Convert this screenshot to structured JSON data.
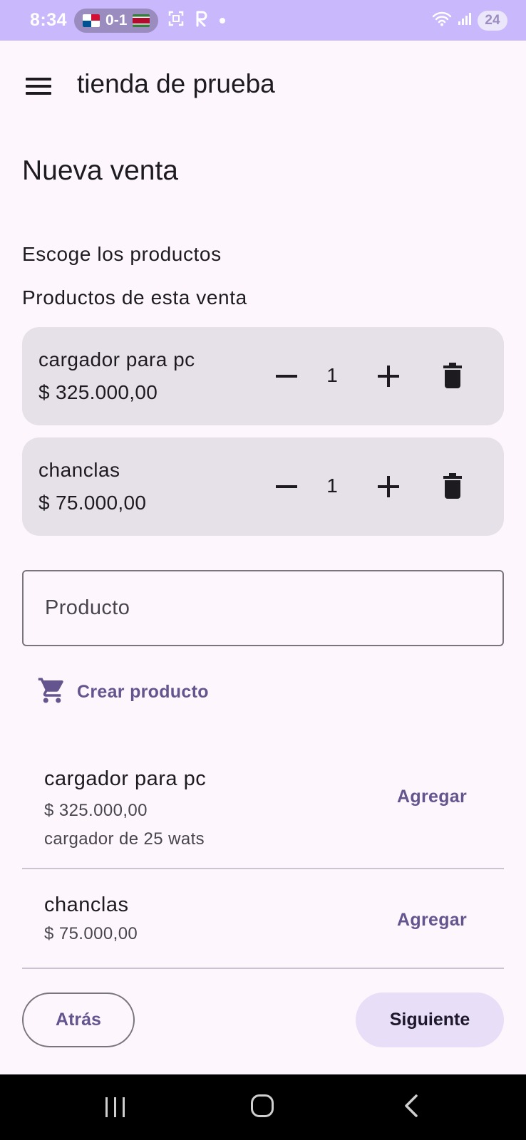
{
  "status_bar": {
    "time": "8:34",
    "score": "0-1",
    "battery": "24"
  },
  "app_bar": {
    "title": "tienda de prueba"
  },
  "page": {
    "title": "Nueva venta",
    "choose_label": "Escoge los productos",
    "sale_products_label": "Productos de esta venta"
  },
  "cart_items": [
    {
      "name": "cargador para pc",
      "price": "$ 325.000,00",
      "quantity": "1"
    },
    {
      "name": "chanclas",
      "price": "$ 75.000,00",
      "quantity": "1"
    }
  ],
  "search": {
    "placeholder": "Producto",
    "value": ""
  },
  "create_product": {
    "label": "Crear producto"
  },
  "product_list": [
    {
      "name": "cargador para pc",
      "price": "$ 325.000,00",
      "description": "cargador de 25 wats",
      "action": "Agregar"
    },
    {
      "name": "chanclas",
      "price": "$ 75.000,00",
      "action": "Agregar"
    }
  ],
  "footer": {
    "back_label": "Atrás",
    "next_label": "Siguiente"
  },
  "colors": {
    "status_bar": "#c9b8fb",
    "background": "#fdf7fd",
    "card": "#e6e1e8",
    "accent": "#65558f",
    "tonal_button": "#e8def8"
  }
}
